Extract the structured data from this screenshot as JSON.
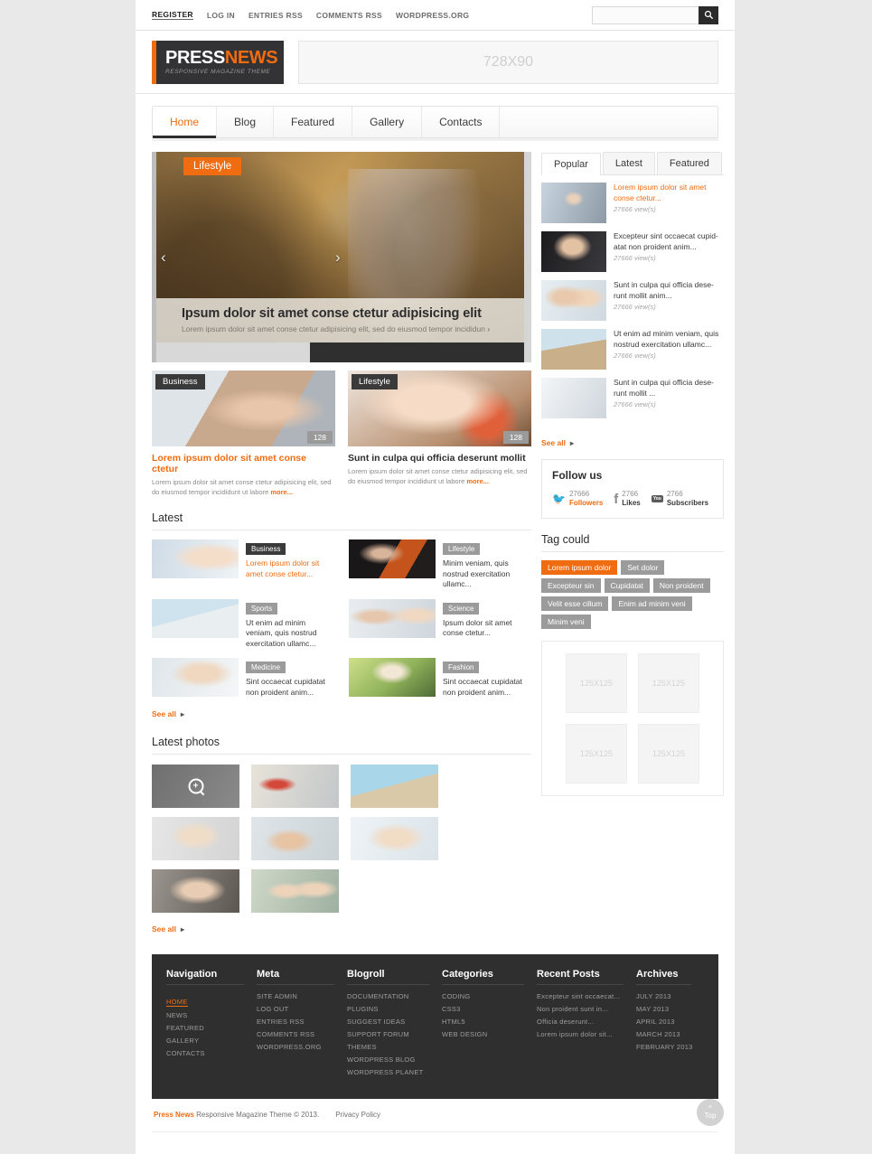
{
  "colors": {
    "accent": "#ef6c11",
    "dark": "#2f2f2f",
    "gray_badge": "#9b9b9b"
  },
  "topbar": {
    "links": [
      {
        "label": "REGISTER",
        "active": true
      },
      {
        "label": "LOG IN",
        "active": false
      },
      {
        "label": "ENTRIES RSS",
        "active": false
      },
      {
        "label": "COMMENTS RSS",
        "active": false
      },
      {
        "label": "WORDPRESS.ORG",
        "active": false
      }
    ],
    "search_placeholder": "",
    "search_value": ""
  },
  "header": {
    "logo_primary": "PRESS",
    "logo_secondary": "NEWS",
    "logo_tagline": "RESPONSIVE MAGAZINE THEME",
    "banner_label": "728X90"
  },
  "nav": {
    "tabs": [
      {
        "label": "Home",
        "active": true
      },
      {
        "label": "Blog",
        "active": false
      },
      {
        "label": "Featured",
        "active": false
      },
      {
        "label": "Gallery",
        "active": false
      },
      {
        "label": "Contacts",
        "active": false
      }
    ]
  },
  "slider": {
    "category": "Lifestyle",
    "title": "Ipsum dolor sit amet conse ctetur adipisicing elit",
    "excerpt": "Lorem ipsum dolor sit amet conse ctetur adipisicing elit, sed do eiusmod tempor incididun",
    "prev_icon": "chevron-left-icon",
    "next_icon": "chevron-right-icon"
  },
  "features": [
    {
      "category": "Business",
      "count": "128",
      "title": "Lorem ipsum dolor sit amet conse ctetur",
      "excerpt": "Lorem ipsum dolor sit amet conse ctetur adipisicing elit, sed do eiusmod tempor incididunt ut labore",
      "more": "more..."
    },
    {
      "category": "Lifestyle",
      "count": "128",
      "title": "Sunt in culpa qui officia deserunt mollit",
      "excerpt": "Lorem ipsum dolor sit amet conse ctetur adipisicing elit, sed do eiusmod tempor incididunt ut labore",
      "more": "more..."
    }
  ],
  "latest": {
    "heading": "Latest",
    "see_all": "See all",
    "items": [
      {
        "category": "Business",
        "title": "Lorem ipsum dolor sit amet conse ctetur..."
      },
      {
        "category": "Lifestyle",
        "title": "Minim veniam, quis nostrud exercitation ullamc..."
      },
      {
        "category": "Sports",
        "title": "Ut enim ad minim veniam, quis nostrud exercitation ullamc..."
      },
      {
        "category": "Science",
        "title": "Ipsum dolor sit amet conse ctetur..."
      },
      {
        "category": "Medicine",
        "title": "Sint occaecat cupidatat non proident anim..."
      },
      {
        "category": "Fashion",
        "title": "Sint occaecat cupidatat non proident anim..."
      }
    ]
  },
  "photos": {
    "heading": "Latest photos",
    "see_all": "See all",
    "count": 8
  },
  "sidebar": {
    "tabs": [
      {
        "label": "Popular",
        "active": true
      },
      {
        "label": "Latest",
        "active": false
      },
      {
        "label": "Featured",
        "active": false
      }
    ],
    "posts": [
      {
        "title": "Lorem ipsum dolor sit amet conse ctetur...",
        "views": "27666 view(s)"
      },
      {
        "title": "Excepteur sint occaecat cupid-atat non proident anim...",
        "views": "27666 view(s)"
      },
      {
        "title": "Sunt in culpa qui officia dese-runt mollit anim...",
        "views": "27666 view(s)"
      },
      {
        "title": "Ut enim ad minim veniam, quis nostrud exercitation ullamc...",
        "views": "27666 view(s)"
      },
      {
        "title": "Sunt in culpa qui officia dese-runt mollit ...",
        "views": "27666 view(s)"
      }
    ],
    "see_all": "See all",
    "follow": {
      "heading": "Follow us",
      "items": [
        {
          "icon": "twitter-icon",
          "number": "27666",
          "label": "Followers"
        },
        {
          "icon": "facebook-icon",
          "number": "2766",
          "label": "Likes"
        },
        {
          "icon": "youtube-icon",
          "number": "2766",
          "label": "Subscribers"
        }
      ]
    },
    "tagcloud": {
      "heading": "Tag could",
      "tags": [
        {
          "label": "Lorem ipsum dolor",
          "active": true
        },
        {
          "label": "Set dolor",
          "active": false
        },
        {
          "label": "Excepteur sin",
          "active": false
        },
        {
          "label": "Cupidatat",
          "active": false
        },
        {
          "label": "Non proident",
          "active": false
        },
        {
          "label": "Velit esse cillum",
          "active": false
        },
        {
          "label": "Enim ad minim veni",
          "active": false
        },
        {
          "label": "Minim veni",
          "active": false
        }
      ]
    },
    "ads": [
      "125X125",
      "125X125",
      "125X125",
      "125X125"
    ]
  },
  "footer": {
    "columns": [
      {
        "heading": "Navigation",
        "links": [
          {
            "label": "HOME",
            "active": true
          },
          {
            "label": "NEWS",
            "active": false
          },
          {
            "label": "FEATURED",
            "active": false
          },
          {
            "label": "GALLERY",
            "active": false
          },
          {
            "label": "CONTACTS",
            "active": false
          }
        ]
      },
      {
        "heading": "Meta",
        "links": [
          {
            "label": "SITE ADMIN",
            "active": false
          },
          {
            "label": "LOG OUT",
            "active": false
          },
          {
            "label": "ENTRIES RSS",
            "active": false
          },
          {
            "label": "COMMENTS RSS",
            "active": false
          },
          {
            "label": "WORDPRESS.ORG",
            "active": false
          }
        ]
      },
      {
        "heading": "Blogroll",
        "links": [
          {
            "label": "DOCUMENTATION",
            "active": false
          },
          {
            "label": "PLUGINS",
            "active": false
          },
          {
            "label": "SUGGEST IDEAS",
            "active": false
          },
          {
            "label": "SUPPORT FORUM",
            "active": false
          },
          {
            "label": "THEMES",
            "active": false
          },
          {
            "label": "WORDPRESS BLOG",
            "active": false
          },
          {
            "label": "WORDPRESS PLANET",
            "active": false
          }
        ]
      },
      {
        "heading": "Categories",
        "links": [
          {
            "label": "CODING",
            "active": false
          },
          {
            "label": "CSS3",
            "active": false
          },
          {
            "label": "HTML5",
            "active": false
          },
          {
            "label": "WEB DESIGN",
            "active": false
          }
        ]
      },
      {
        "heading": "Recent Posts",
        "links": [
          {
            "label": "Excepteur sint occaecat...",
            "active": false
          },
          {
            "label": "Non proident sunt in...",
            "active": false
          },
          {
            "label": "Officia deserunt...",
            "active": false
          },
          {
            "label": "Lorem ipsum dolor sit...",
            "active": false
          }
        ]
      },
      {
        "heading": "Archives",
        "links": [
          {
            "label": "JULY 2013",
            "active": false
          },
          {
            "label": "MAY 2013",
            "active": false
          },
          {
            "label": "APRIL 2013",
            "active": false
          },
          {
            "label": "MARCH 2013",
            "active": false
          },
          {
            "label": "FEBRUARY 2013",
            "active": false
          }
        ]
      }
    ]
  },
  "copyright": {
    "brand": "Press News",
    "text": "Responsive Magazine Theme © 2013.",
    "privacy": "Privacy Policy"
  },
  "totop": {
    "label": "Top",
    "icon": "chevron-up-icon"
  }
}
